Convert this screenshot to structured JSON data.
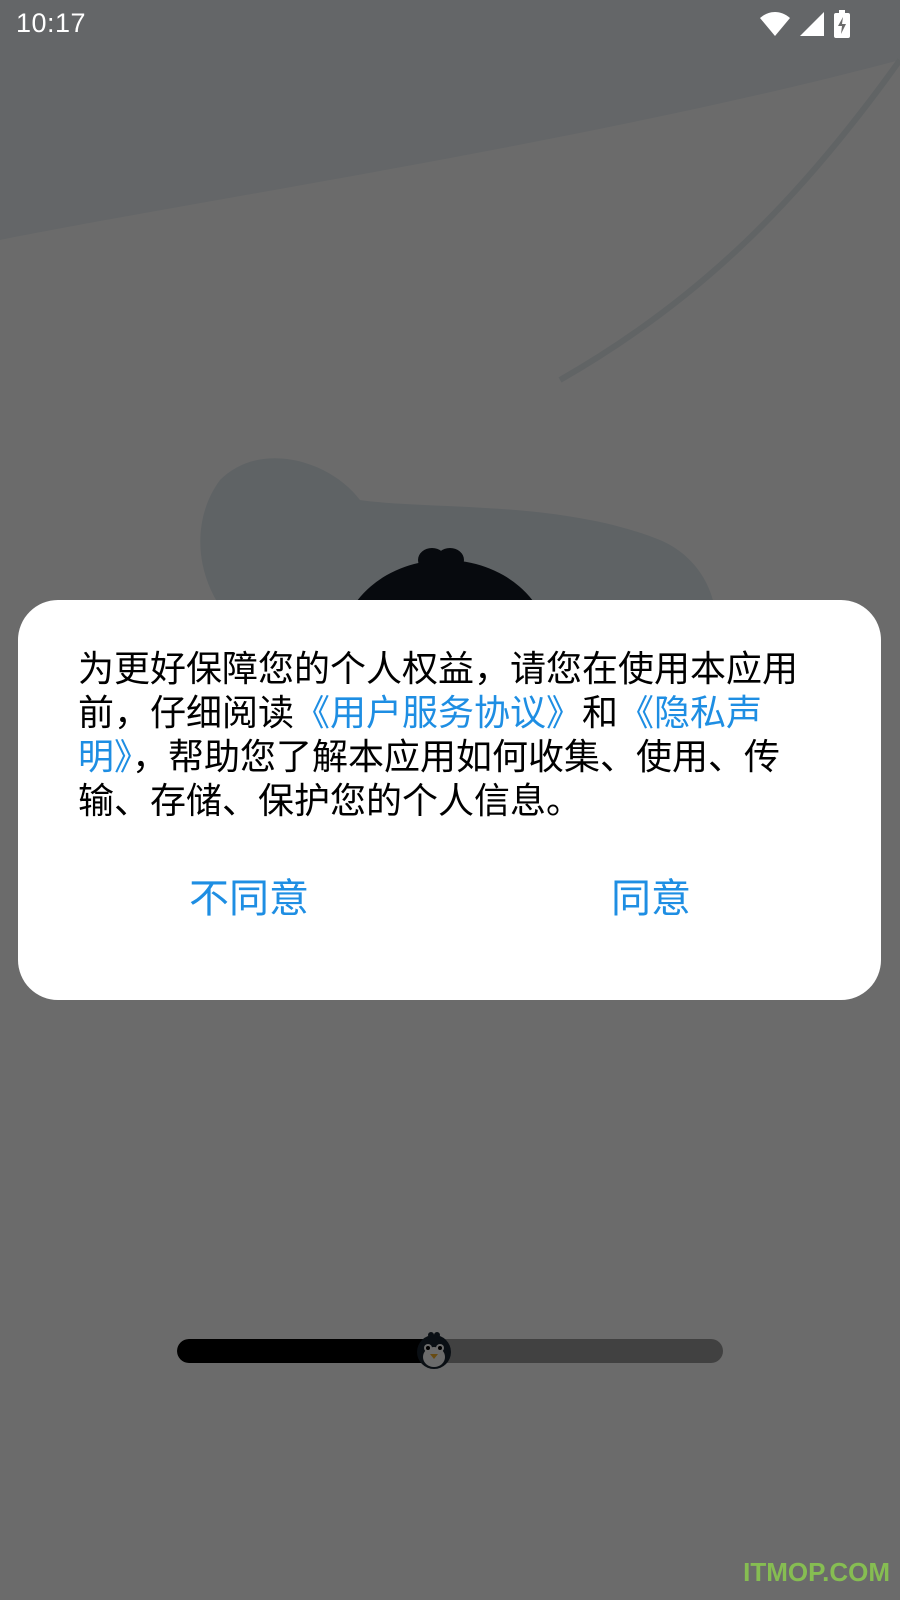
{
  "status_bar": {
    "time": "10:17",
    "icons": [
      "wifi-icon",
      "cellular-signal-icon",
      "battery-charging-icon"
    ]
  },
  "splash": {
    "mascot": "penguin",
    "progress_fraction": 0.47
  },
  "dialog": {
    "message_part1": "为更好保障您的个人权益，请您在使用本应用前，仔细阅读",
    "link_user_agreement": "《用户服务协议》",
    "message_part2": "和",
    "link_privacy": "《隐私声明》",
    "message_part3": "，帮助您了解本应用如何收集、使用、传输、存储、保护您的个人信息。",
    "disagree_label": "不同意",
    "agree_label": "同意"
  },
  "colors": {
    "link": "#1e8ee3",
    "scrim": "rgba(0,0,0,0.58)"
  },
  "watermark": "ITMOP.COM"
}
